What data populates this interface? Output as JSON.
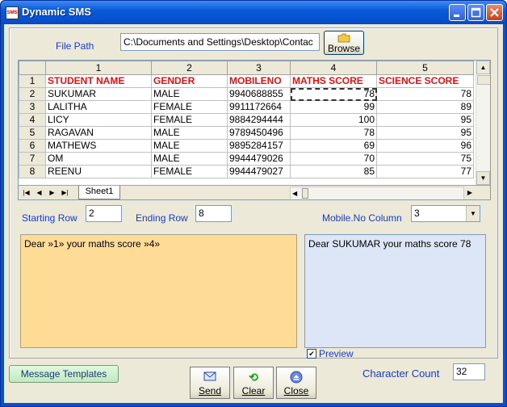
{
  "window": {
    "title": "Dynamic SMS",
    "icon_text": "SMS"
  },
  "file": {
    "label": "File Path",
    "path": "C:\\Documents and Settings\\Desktop\\Contac",
    "browse_label": "Browse"
  },
  "sheet": {
    "col_numbers": [
      "1",
      "2",
      "3",
      "4",
      "5"
    ],
    "header_row_number": "1",
    "headers": [
      "STUDENT NAME",
      "GENDER",
      "MOBILENO",
      "MATHS SCORE",
      "SCIENCE SCORE"
    ],
    "rows": [
      {
        "num": "2",
        "cells": [
          "SUKUMAR",
          "MALE",
          "9940688855",
          "78",
          "78"
        ]
      },
      {
        "num": "3",
        "cells": [
          "LALITHA",
          "FEMALE",
          "9911172664",
          "99",
          "89"
        ]
      },
      {
        "num": "4",
        "cells": [
          "LICY",
          "FEMALE",
          "9884294444",
          "100",
          "95"
        ]
      },
      {
        "num": "5",
        "cells": [
          "RAGAVAN",
          "MALE",
          "9789450496",
          "78",
          "95"
        ]
      },
      {
        "num": "6",
        "cells": [
          "MATHEWS",
          "MALE",
          "9895284157",
          "69",
          "96"
        ]
      },
      {
        "num": "7",
        "cells": [
          "OM",
          "MALE",
          "9944479026",
          "70",
          "75"
        ]
      },
      {
        "num": "8",
        "cells": [
          "REENU",
          "FEMALE",
          "9944479027",
          "85",
          "77"
        ]
      }
    ],
    "tab_name": "Sheet1"
  },
  "range": {
    "start_label": "Starting Row",
    "start_value": "2",
    "end_label": "Ending Row",
    "end_value": "8",
    "mobile_label": "Mobile.No Column",
    "mobile_value": "3"
  },
  "message": {
    "template": "Dear »1» your maths score »4»",
    "preview": "Dear SUKUMAR your maths score 78",
    "preview_label": "Preview",
    "preview_checked": true,
    "template_color": "#ffdc96",
    "preview_color": "#dce6f6"
  },
  "footer": {
    "templates_button": "Message Templates",
    "send": "Send",
    "clear": "Clear",
    "close": "Close",
    "char_count_label": "Character Count",
    "char_count_value": "32"
  }
}
